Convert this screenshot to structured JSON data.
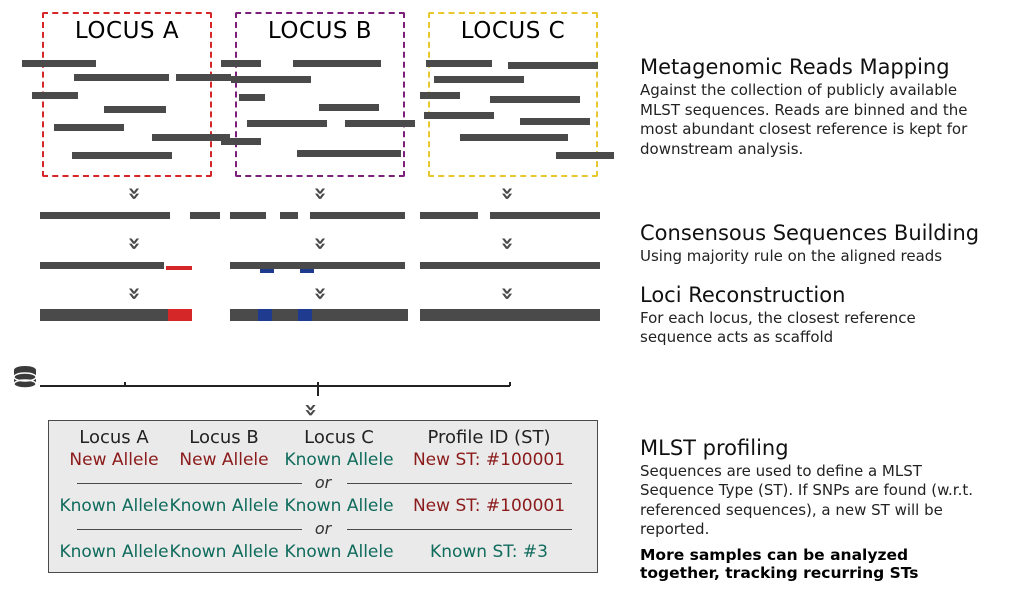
{
  "loci": {
    "a": {
      "title": "LOCUS A",
      "color": "#d62728"
    },
    "b": {
      "title": "LOCUS B",
      "color": "#7b1f7b"
    },
    "c": {
      "title": "LOCUS C",
      "color": "#e8c82e"
    }
  },
  "steps": {
    "mapping": {
      "title": "Metagenomic Reads Mapping",
      "desc": "Against the collection of publicly available MLST sequences. Reads are binned and the most abundant closest reference is kept for downstream analysis."
    },
    "consensus": {
      "title": "Consensous Sequences Building",
      "desc": "Using majority rule on the aligned reads"
    },
    "reconstruction": {
      "title": "Loci Reconstruction",
      "desc": "For each locus, the closest reference sequence acts as scaffold"
    },
    "profiling": {
      "title": "MLST profiling",
      "desc": "Sequences are used to define a MLST Sequence Type (ST). If SNPs are found (w.r.t. referenced sequences), a new ST will be reported.",
      "bold": "More samples can be analyzed together, tracking recurring STs"
    }
  },
  "profile": {
    "headers": {
      "c1": "Locus A",
      "c2": "Locus B",
      "c3": "Locus C",
      "c4": "Profile ID (ST)"
    },
    "or": "or",
    "rows": [
      {
        "a": "New Allele",
        "a_cls": "new-allele",
        "b": "New Allele",
        "b_cls": "new-allele",
        "c": "Known Allele",
        "c_cls": "known-allele",
        "st": "New ST: #100001",
        "st_cls": "new-st"
      },
      {
        "a": "Known Allele",
        "a_cls": "known-allele",
        "b": "Known Allele",
        "b_cls": "known-allele",
        "c": "Known Allele",
        "c_cls": "known-allele",
        "st": "New ST: #100001",
        "st_cls": "new-st"
      },
      {
        "a": "Known Allele",
        "a_cls": "known-allele",
        "b": "Known Allele",
        "b_cls": "known-allele",
        "c": "Known Allele",
        "c_cls": "known-allele",
        "st": "Known ST: #3",
        "st_cls": "known-st"
      }
    ]
  },
  "arrow": "»",
  "chart_data": {
    "type": "diagram-pipeline",
    "stages": [
      {
        "name": "Metagenomic Reads Mapping",
        "loci": [
          "LOCUS A",
          "LOCUS B",
          "LOCUS C"
        ],
        "read_segments_per_locus_approx": 8
      },
      {
        "name": "Consensous Sequences Building",
        "segments_per_locus_approx": 3
      },
      {
        "name": "Loci Reconstruction",
        "loci_variants": {
          "LOCUS A": "red SNP tick",
          "LOCUS B": "blue SNP ticks",
          "LOCUS C": "none"
        }
      },
      {
        "name": "Compare to MLST database",
        "input": "3 reconstructed loci",
        "output": "profile table"
      },
      {
        "name": "MLST profiling",
        "cases": 3
      }
    ]
  }
}
